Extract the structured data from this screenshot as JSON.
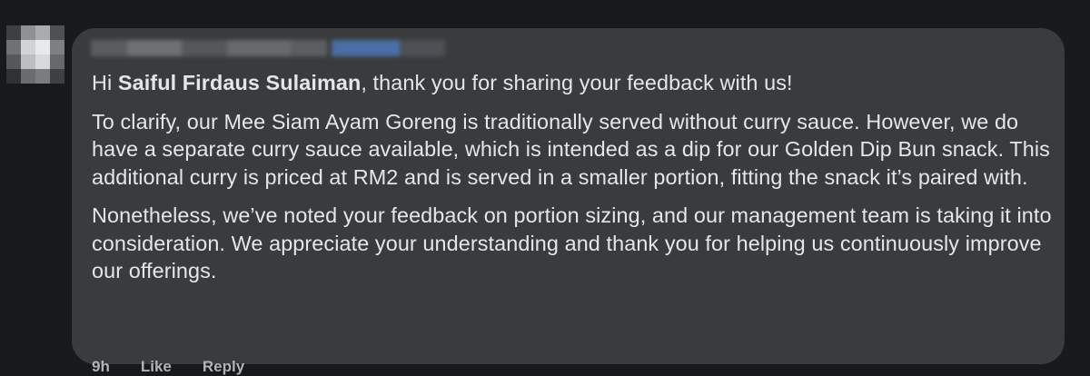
{
  "comment": {
    "greeting_prefix": "Hi ",
    "mention_name": "Saiful Firdaus Sulaiman",
    "greeting_suffix": ", thank you for sharing your feedback with us!",
    "paragraph_2": "To clarify, our Mee Siam Ayam Goreng is traditionally served without curry sauce. However, we do have a separate curry sauce available, which is intended as a dip for our Golden Dip Bun snack. This additional curry is priced at RM2 and is served in a smaller portion, fitting the snack it’s paired with.",
    "paragraph_3": "Nonetheless, we’ve noted your feedback on portion sizing, and our management team is taking it into consideration. We appreciate your understanding and thank you for helping us continuously improve our offerings."
  },
  "actions": {
    "time": "9h",
    "like": "Like",
    "reply": "Reply"
  },
  "colors": {
    "page_background": "#18191a",
    "bubble_background": "#3a3b3c",
    "text_primary": "#e4e6eb",
    "text_secondary": "#b0b3b8"
  }
}
